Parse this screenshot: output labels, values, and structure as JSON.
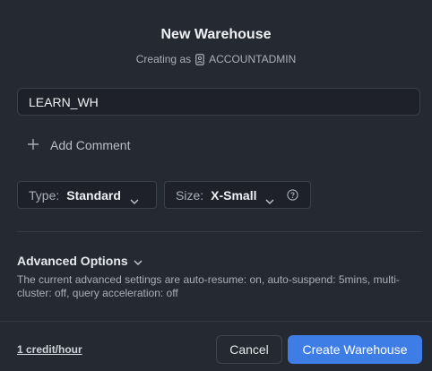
{
  "dialog": {
    "title": "New Warehouse",
    "subtitle_prefix": "Creating as",
    "role": "ACCOUNTADMIN",
    "role_icon": "user-badge-icon"
  },
  "name_input": {
    "value": "LEARN_WH",
    "placeholder": ""
  },
  "add_comment": {
    "label": "Add Comment",
    "icon": "plus-icon"
  },
  "type_select": {
    "label": "Type:",
    "value": "Standard"
  },
  "size_select": {
    "label": "Size:",
    "value": "X-Small",
    "info_icon": "info-circle-icon"
  },
  "advanced": {
    "title": "Advanced Options",
    "description": "The current advanced settings are auto-resume: on, auto-suspend: 5mins, multi-cluster: off, query acceleration: off"
  },
  "footer": {
    "credit_text": "1 credit/hour",
    "cancel_label": "Cancel",
    "create_label": "Create Warehouse"
  },
  "colors": {
    "background": "#252932",
    "input_background": "#1e2129",
    "primary": "#3f7de6",
    "muted_text": "#a9aeb8"
  }
}
